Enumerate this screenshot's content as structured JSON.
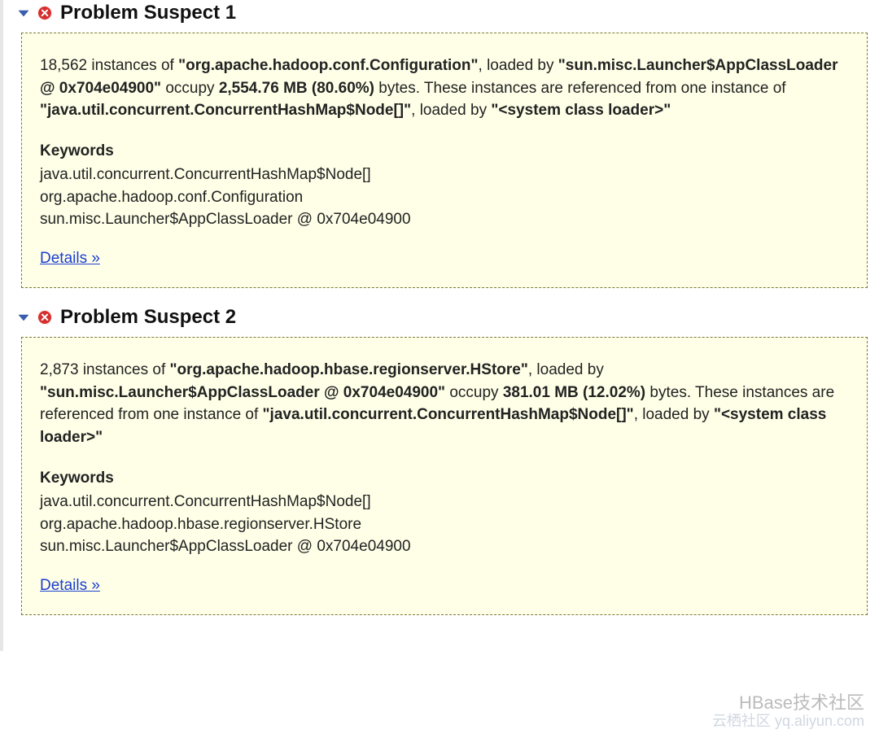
{
  "suspects": [
    {
      "title": "Problem Suspect 1",
      "instances": "18,562",
      "class_name": "\"org.apache.hadoop.conf.Configuration\"",
      "loader": "\"sun.misc.Launcher$AppClassLoader @ 0x704e04900\"",
      "size": "2,554.76 MB (80.60%)",
      "ref_class": "\"java.util.concurrent.ConcurrentHashMap$Node[]\"",
      "ref_loader": "\"<system class loader>\"",
      "keywords_heading": "Keywords",
      "keywords": [
        "java.util.concurrent.ConcurrentHashMap$Node[]",
        "org.apache.hadoop.conf.Configuration",
        "sun.misc.Launcher$AppClassLoader @ 0x704e04900"
      ],
      "details_label": "Details »"
    },
    {
      "title": "Problem Suspect 2",
      "instances": "2,873",
      "class_name": "\"org.apache.hadoop.hbase.regionserver.HStore\"",
      "loader": "\"sun.misc.Launcher$AppClassLoader @ 0x704e04900\"",
      "size": "381.01 MB (12.02%)",
      "ref_class": "\"java.util.concurrent.ConcurrentHashMap$Node[]\"",
      "ref_loader": "\"<system class loader>\"",
      "keywords_heading": "Keywords",
      "keywords": [
        "java.util.concurrent.ConcurrentHashMap$Node[]",
        "org.apache.hadoop.hbase.regionserver.HStore",
        "sun.misc.Launcher$AppClassLoader @ 0x704e04900"
      ],
      "details_label": "Details »"
    }
  ],
  "text": {
    "instances_of": " instances of ",
    "loaded_by": ", loaded by ",
    "occupy": " occupy ",
    "bytes_referenced": " bytes. These instances are referenced from one instance of ",
    "loaded_by2": ", loaded by "
  },
  "watermark": {
    "line1": "HBase技术社区",
    "line2": "云栖社区 yq.aliyun.com"
  }
}
